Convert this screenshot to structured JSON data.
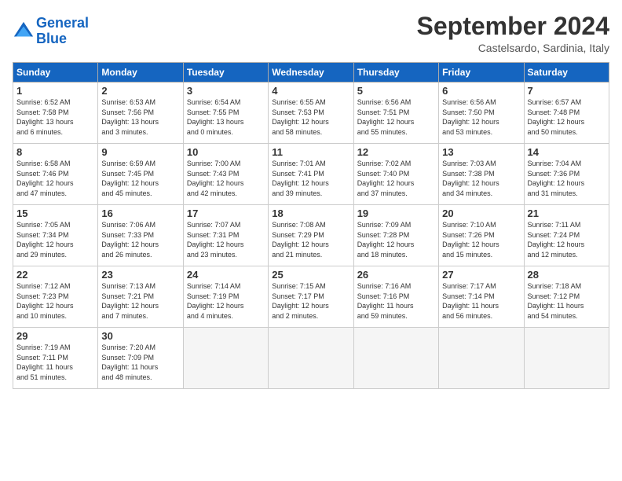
{
  "header": {
    "logo_line1": "General",
    "logo_line2": "Blue",
    "month_title": "September 2024",
    "location": "Castelsardo, Sardinia, Italy"
  },
  "weekdays": [
    "Sunday",
    "Monday",
    "Tuesday",
    "Wednesday",
    "Thursday",
    "Friday",
    "Saturday"
  ],
  "days": [
    {
      "num": "",
      "info": ""
    },
    {
      "num": "",
      "info": ""
    },
    {
      "num": "",
      "info": ""
    },
    {
      "num": "1",
      "info": "Sunrise: 6:52 AM\nSunset: 7:58 PM\nDaylight: 13 hours\nand 6 minutes."
    },
    {
      "num": "2",
      "info": "Sunrise: 6:53 AM\nSunset: 7:56 PM\nDaylight: 13 hours\nand 3 minutes."
    },
    {
      "num": "3",
      "info": "Sunrise: 6:54 AM\nSunset: 7:55 PM\nDaylight: 13 hours\nand 0 minutes."
    },
    {
      "num": "4",
      "info": "Sunrise: 6:55 AM\nSunset: 7:53 PM\nDaylight: 12 hours\nand 58 minutes."
    },
    {
      "num": "5",
      "info": "Sunrise: 6:56 AM\nSunset: 7:51 PM\nDaylight: 12 hours\nand 55 minutes."
    },
    {
      "num": "6",
      "info": "Sunrise: 6:56 AM\nSunset: 7:50 PM\nDaylight: 12 hours\nand 53 minutes."
    },
    {
      "num": "7",
      "info": "Sunrise: 6:57 AM\nSunset: 7:48 PM\nDaylight: 12 hours\nand 50 minutes."
    },
    {
      "num": "8",
      "info": "Sunrise: 6:58 AM\nSunset: 7:46 PM\nDaylight: 12 hours\nand 47 minutes."
    },
    {
      "num": "9",
      "info": "Sunrise: 6:59 AM\nSunset: 7:45 PM\nDaylight: 12 hours\nand 45 minutes."
    },
    {
      "num": "10",
      "info": "Sunrise: 7:00 AM\nSunset: 7:43 PM\nDaylight: 12 hours\nand 42 minutes."
    },
    {
      "num": "11",
      "info": "Sunrise: 7:01 AM\nSunset: 7:41 PM\nDaylight: 12 hours\nand 39 minutes."
    },
    {
      "num": "12",
      "info": "Sunrise: 7:02 AM\nSunset: 7:40 PM\nDaylight: 12 hours\nand 37 minutes."
    },
    {
      "num": "13",
      "info": "Sunrise: 7:03 AM\nSunset: 7:38 PM\nDaylight: 12 hours\nand 34 minutes."
    },
    {
      "num": "14",
      "info": "Sunrise: 7:04 AM\nSunset: 7:36 PM\nDaylight: 12 hours\nand 31 minutes."
    },
    {
      "num": "15",
      "info": "Sunrise: 7:05 AM\nSunset: 7:34 PM\nDaylight: 12 hours\nand 29 minutes."
    },
    {
      "num": "16",
      "info": "Sunrise: 7:06 AM\nSunset: 7:33 PM\nDaylight: 12 hours\nand 26 minutes."
    },
    {
      "num": "17",
      "info": "Sunrise: 7:07 AM\nSunset: 7:31 PM\nDaylight: 12 hours\nand 23 minutes."
    },
    {
      "num": "18",
      "info": "Sunrise: 7:08 AM\nSunset: 7:29 PM\nDaylight: 12 hours\nand 21 minutes."
    },
    {
      "num": "19",
      "info": "Sunrise: 7:09 AM\nSunset: 7:28 PM\nDaylight: 12 hours\nand 18 minutes."
    },
    {
      "num": "20",
      "info": "Sunrise: 7:10 AM\nSunset: 7:26 PM\nDaylight: 12 hours\nand 15 minutes."
    },
    {
      "num": "21",
      "info": "Sunrise: 7:11 AM\nSunset: 7:24 PM\nDaylight: 12 hours\nand 12 minutes."
    },
    {
      "num": "22",
      "info": "Sunrise: 7:12 AM\nSunset: 7:23 PM\nDaylight: 12 hours\nand 10 minutes."
    },
    {
      "num": "23",
      "info": "Sunrise: 7:13 AM\nSunset: 7:21 PM\nDaylight: 12 hours\nand 7 minutes."
    },
    {
      "num": "24",
      "info": "Sunrise: 7:14 AM\nSunset: 7:19 PM\nDaylight: 12 hours\nand 4 minutes."
    },
    {
      "num": "25",
      "info": "Sunrise: 7:15 AM\nSunset: 7:17 PM\nDaylight: 12 hours\nand 2 minutes."
    },
    {
      "num": "26",
      "info": "Sunrise: 7:16 AM\nSunset: 7:16 PM\nDaylight: 11 hours\nand 59 minutes."
    },
    {
      "num": "27",
      "info": "Sunrise: 7:17 AM\nSunset: 7:14 PM\nDaylight: 11 hours\nand 56 minutes."
    },
    {
      "num": "28",
      "info": "Sunrise: 7:18 AM\nSunset: 7:12 PM\nDaylight: 11 hours\nand 54 minutes."
    },
    {
      "num": "29",
      "info": "Sunrise: 7:19 AM\nSunset: 7:11 PM\nDaylight: 11 hours\nand 51 minutes."
    },
    {
      "num": "30",
      "info": "Sunrise: 7:20 AM\nSunset: 7:09 PM\nDaylight: 11 hours\nand 48 minutes."
    },
    {
      "num": "",
      "info": ""
    },
    {
      "num": "",
      "info": ""
    },
    {
      "num": "",
      "info": ""
    },
    {
      "num": "",
      "info": ""
    },
    {
      "num": "",
      "info": ""
    }
  ]
}
